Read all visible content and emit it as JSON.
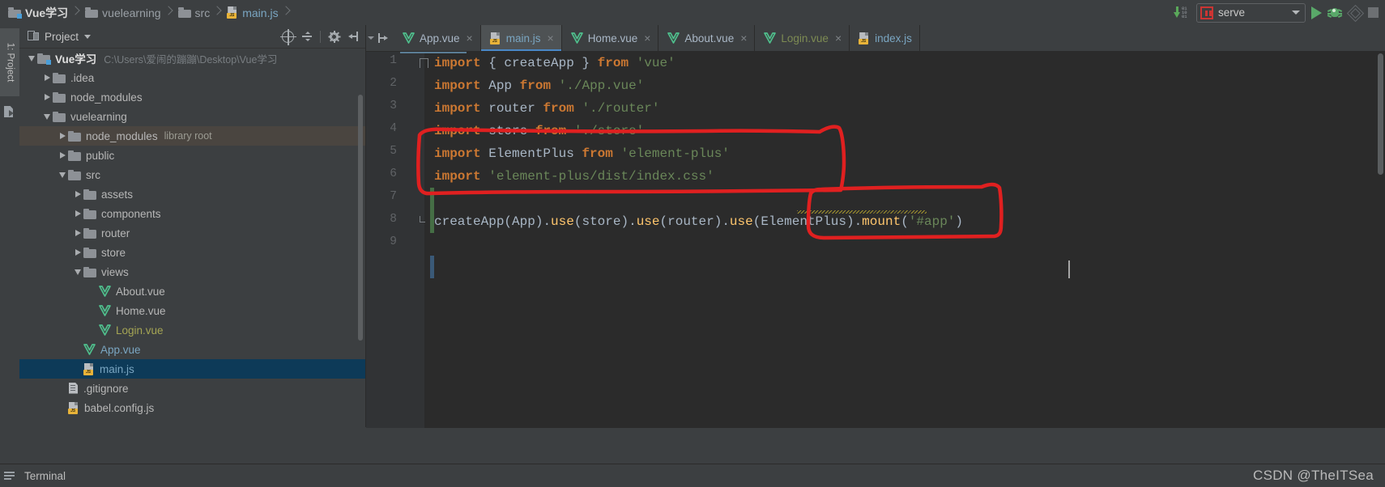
{
  "breadcrumb": {
    "items": [
      {
        "label": "Vue学习",
        "icon": "folder-module-icon",
        "kind": "project"
      },
      {
        "label": "vuelearning",
        "icon": "folder-icon",
        "kind": "folder"
      },
      {
        "label": "src",
        "icon": "folder-icon",
        "kind": "folder"
      },
      {
        "label": "main.js",
        "icon": "js-file-icon",
        "kind": "file"
      }
    ]
  },
  "toolbar": {
    "update_project_icon": "update-project-icon",
    "update_digits": [
      "01",
      "10",
      "01"
    ],
    "run_config": {
      "icon": "npm-icon",
      "label": "serve",
      "caret": "chevron-down-icon"
    },
    "run_label": "Run",
    "debug_label": "Debug",
    "coverage_label": "Run with Coverage",
    "stop_label": "Stop"
  },
  "left_stripe": {
    "tab_label": "1: Project",
    "structure_icon": "structure-icon"
  },
  "project_panel": {
    "header": {
      "icon": "project-view-icon",
      "title": "Project",
      "caret": "chevron-down-icon",
      "tools": [
        {
          "name": "scroll-from-source-icon",
          "label": "Select Opened File"
        },
        {
          "name": "collapse-all-icon",
          "label": "Collapse All"
        },
        {
          "name": "settings-gear-icon",
          "label": "Settings"
        },
        {
          "name": "hide-panel-icon",
          "label": "Hide"
        }
      ]
    },
    "tree": [
      {
        "label": "Vue学习",
        "path": "C:\\Users\\爱闹的蹦蹦\\Desktop\\Vue学习",
        "indent": 0,
        "twisty": "open",
        "icon": "folder-module-icon",
        "color": "root"
      },
      {
        "label": ".idea",
        "indent": 1,
        "twisty": "closed",
        "icon": "folder-icon",
        "color": "normal"
      },
      {
        "label": "node_modules",
        "indent": 1,
        "twisty": "closed",
        "icon": "folder-icon",
        "color": "normal"
      },
      {
        "label": "vuelearning",
        "indent": 1,
        "twisty": "open",
        "icon": "folder-icon",
        "color": "normal"
      },
      {
        "label": "node_modules",
        "hint": "library root",
        "indent": 2,
        "twisty": "closed",
        "icon": "folder-icon",
        "color": "normal",
        "hover": true
      },
      {
        "label": "public",
        "indent": 2,
        "twisty": "closed",
        "icon": "folder-icon",
        "color": "normal"
      },
      {
        "label": "src",
        "indent": 2,
        "twisty": "open",
        "icon": "folder-icon",
        "color": "normal"
      },
      {
        "label": "assets",
        "indent": 3,
        "twisty": "closed",
        "icon": "folder-icon",
        "color": "normal"
      },
      {
        "label": "components",
        "indent": 3,
        "twisty": "closed",
        "icon": "folder-icon",
        "color": "normal"
      },
      {
        "label": "router",
        "indent": 3,
        "twisty": "closed",
        "icon": "folder-icon",
        "color": "normal"
      },
      {
        "label": "store",
        "indent": 3,
        "twisty": "closed",
        "icon": "folder-icon",
        "color": "normal"
      },
      {
        "label": "views",
        "indent": 3,
        "twisty": "open",
        "icon": "folder-icon",
        "color": "normal"
      },
      {
        "label": "About.vue",
        "indent": 4,
        "twisty": "none",
        "icon": "vue-file-icon",
        "color": "normal"
      },
      {
        "label": "Home.vue",
        "indent": 4,
        "twisty": "none",
        "icon": "vue-file-icon",
        "color": "normal"
      },
      {
        "label": "Login.vue",
        "indent": 4,
        "twisty": "none",
        "icon": "vue-file-icon",
        "color": "olive"
      },
      {
        "label": "App.vue",
        "indent": 3,
        "twisty": "none",
        "icon": "vue-file-icon",
        "color": "blue"
      },
      {
        "label": "main.js",
        "indent": 3,
        "twisty": "none",
        "icon": "js-file-icon",
        "color": "blue",
        "selected": true
      },
      {
        "label": ".gitignore",
        "indent": 2,
        "twisty": "none",
        "icon": "text-file-icon",
        "color": "normal"
      },
      {
        "label": "babel.config.js",
        "indent": 2,
        "twisty": "none",
        "icon": "js-file-icon",
        "color": "normal"
      }
    ]
  },
  "editor": {
    "tabs": [
      {
        "label": "App.vue",
        "icon": "vue-file-icon",
        "color": "vue",
        "active": false,
        "close": "×"
      },
      {
        "label": "main.js",
        "icon": "js-file-icon",
        "color": "js",
        "active": true,
        "close": "×"
      },
      {
        "label": "Home.vue",
        "icon": "vue-file-icon",
        "color": "vue",
        "active": false,
        "close": "×"
      },
      {
        "label": "About.vue",
        "icon": "vue-file-icon",
        "color": "vue",
        "active": false,
        "close": "×"
      },
      {
        "label": "Login.vue",
        "icon": "vue-file-icon",
        "color": "olive",
        "active": false,
        "close": "×"
      },
      {
        "label": "index.js",
        "icon": "js-file-icon",
        "color": "js",
        "active": false,
        "close": ""
      }
    ],
    "line_numbers": [
      "1",
      "2",
      "3",
      "4",
      "5",
      "6",
      "7",
      "8",
      "9"
    ],
    "code_lines": [
      [
        {
          "t": "import",
          "c": "kw"
        },
        {
          "t": " { ",
          "c": "pn"
        },
        {
          "t": "createApp",
          "c": "idf"
        },
        {
          "t": " } ",
          "c": "pn"
        },
        {
          "t": "from",
          "c": "kw"
        },
        {
          "t": " ",
          "c": "pn"
        },
        {
          "t": "'vue'",
          "c": "str"
        }
      ],
      [
        {
          "t": "import",
          "c": "kw"
        },
        {
          "t": " ",
          "c": "pn"
        },
        {
          "t": "App",
          "c": "idf"
        },
        {
          "t": " ",
          "c": "pn"
        },
        {
          "t": "from",
          "c": "kw"
        },
        {
          "t": " ",
          "c": "pn"
        },
        {
          "t": "'./App.vue'",
          "c": "str"
        }
      ],
      [
        {
          "t": "import",
          "c": "kw"
        },
        {
          "t": " ",
          "c": "pn"
        },
        {
          "t": "router",
          "c": "idf"
        },
        {
          "t": " ",
          "c": "pn"
        },
        {
          "t": "from",
          "c": "kw"
        },
        {
          "t": " ",
          "c": "pn"
        },
        {
          "t": "'./router'",
          "c": "str"
        }
      ],
      [
        {
          "t": "import",
          "c": "kw"
        },
        {
          "t": " ",
          "c": "pn"
        },
        {
          "t": "store",
          "c": "idf"
        },
        {
          "t": " ",
          "c": "pn"
        },
        {
          "t": "from",
          "c": "kw"
        },
        {
          "t": " ",
          "c": "pn"
        },
        {
          "t": "'./store'",
          "c": "str"
        }
      ],
      [
        {
          "t": "import",
          "c": "kw"
        },
        {
          "t": " ",
          "c": "pn"
        },
        {
          "t": "ElementPlus",
          "c": "idf"
        },
        {
          "t": " ",
          "c": "pn"
        },
        {
          "t": "from",
          "c": "kw"
        },
        {
          "t": " ",
          "c": "pn"
        },
        {
          "t": "'element-plus'",
          "c": "str"
        }
      ],
      [
        {
          "t": "import",
          "c": "kw"
        },
        {
          "t": " ",
          "c": "pn"
        },
        {
          "t": "'element-plus/dist/index.css'",
          "c": "str"
        }
      ],
      [],
      [
        {
          "t": "createApp",
          "c": "idf"
        },
        {
          "t": "(",
          "c": "pn"
        },
        {
          "t": "App",
          "c": "idf"
        },
        {
          "t": ").",
          "c": "pn"
        },
        {
          "t": "use",
          "c": "fn"
        },
        {
          "t": "(",
          "c": "pn"
        },
        {
          "t": "store",
          "c": "idf"
        },
        {
          "t": ").",
          "c": "pn"
        },
        {
          "t": "use",
          "c": "fn"
        },
        {
          "t": "(",
          "c": "pn"
        },
        {
          "t": "router",
          "c": "idf"
        },
        {
          "t": ").",
          "c": "pn"
        },
        {
          "t": "use",
          "c": "fn"
        },
        {
          "t": "(",
          "c": "pn"
        },
        {
          "t": "ElementPlus",
          "c": "idf"
        },
        {
          "t": ").",
          "c": "pn"
        },
        {
          "t": "mount",
          "c": "fn"
        },
        {
          "t": "(",
          "c": "pn"
        },
        {
          "t": "'#app'",
          "c": "str"
        },
        {
          "t": ")",
          "c": "pn"
        }
      ],
      []
    ],
    "annotations": [
      {
        "name": "import-block-highlight",
        "shape": "hand-drawn-rectangle",
        "color": "#e02020",
        "covers": "lines 5-7 import ElementPlus block"
      },
      {
        "name": "use-elementplus-highlight",
        "shape": "hand-drawn-rectangle",
        "color": "#e02020",
        "covers": ".use(ElementPlus) call on line 8"
      }
    ],
    "warning_underline": {
      "name": "unresolved-module-squiggle",
      "color": "#b0a030",
      "target": "'element-plus'"
    }
  },
  "statusbar": {
    "terminal_label": "Terminal",
    "watermark": "CSDN @TheITSea"
  },
  "colors": {
    "accent": "#4a88c7",
    "selection": "#0d3a58",
    "annotation_red": "#e02020",
    "keyword": "#cc7832",
    "string": "#6a8759",
    "function": "#ffc66d",
    "identifier": "#a9b7c6",
    "editor_bg": "#2b2b2b",
    "panel_bg": "#3c3f41"
  }
}
